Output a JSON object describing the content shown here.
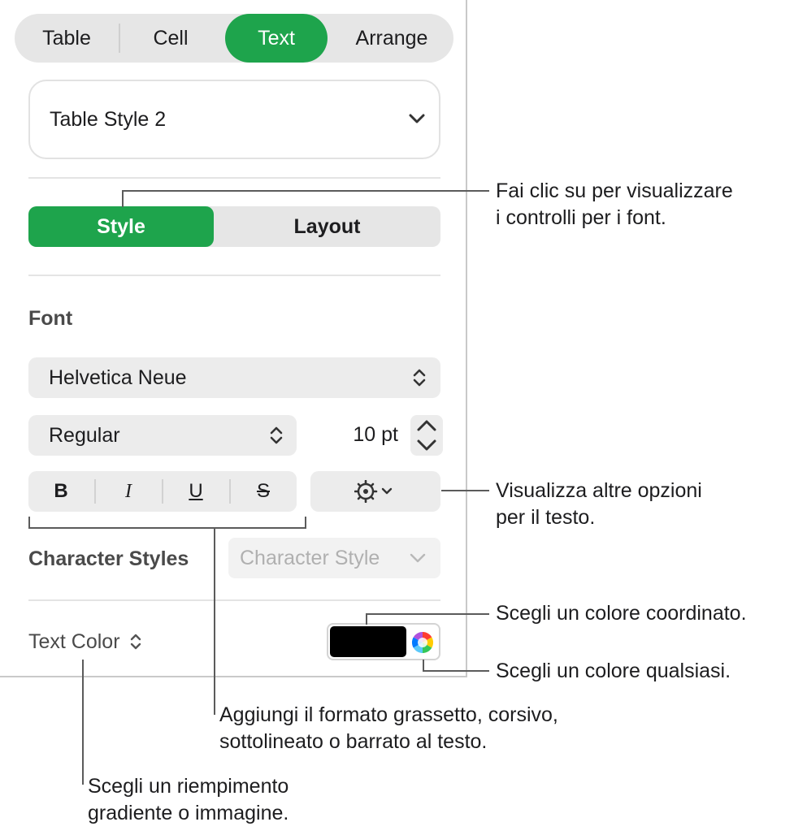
{
  "tabs": [
    "Table",
    "Cell",
    "Text",
    "Arrange"
  ],
  "active_tab": "Text",
  "table_style": {
    "value": "Table Style 2"
  },
  "mode_tabs": [
    "Style",
    "Layout"
  ],
  "font_section": {
    "title": "Font",
    "family": "Helvetica Neue",
    "typeface": "Regular",
    "size": "10 pt",
    "format_buttons": [
      "B",
      "I",
      "U",
      "S"
    ]
  },
  "character_styles": {
    "label": "Character Styles",
    "placeholder": "Character Style"
  },
  "text_color": {
    "label": "Text Color",
    "swatch": "#000000"
  },
  "accent_color": "#1ea44c",
  "callouts": {
    "style_line1": "Fai clic su per visualizzare",
    "style_line2": "i controlli per i font.",
    "more_line1": "Visualizza altre opzioni",
    "more_line2": "per il testo.",
    "coordinated": "Scegli un colore coordinato.",
    "any_color": "Scegli un colore qualsiasi.",
    "format_line1": "Aggiungi il formato grassetto, corsivo,",
    "format_line2": "sottolineato o barrato al testo.",
    "fill_line1": "Scegli un riempimento",
    "fill_line2": "gradiente o immagine."
  }
}
